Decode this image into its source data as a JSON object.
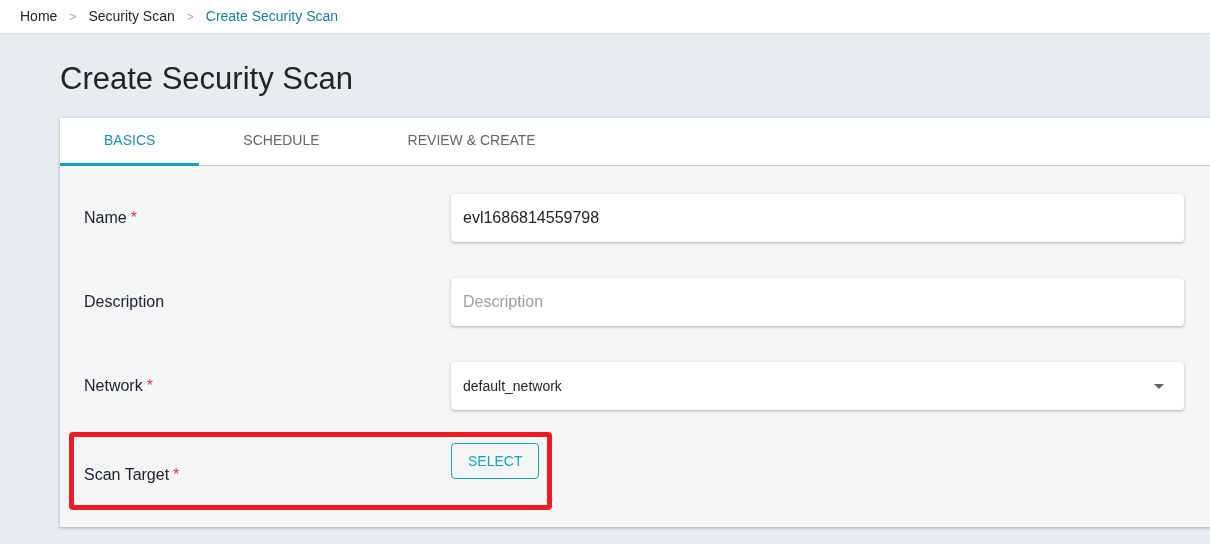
{
  "breadcrumb": [
    {
      "label": "Home",
      "current": false
    },
    {
      "label": "Security Scan",
      "current": false
    },
    {
      "label": "Create Security Scan",
      "current": true
    }
  ],
  "breadcrumb_separator": ">",
  "page_title": "Create Security Scan",
  "tabs": [
    {
      "label": "BASICS",
      "selected": true
    },
    {
      "label": "SCHEDULE",
      "selected": false
    },
    {
      "label": "REVIEW & CREATE",
      "selected": false
    }
  ],
  "fields": [
    {
      "kind": "text",
      "label": "Name",
      "required_mark": "*",
      "value": "evl1686814559798",
      "highlighted": false
    },
    {
      "kind": "text",
      "label": "Description",
      "placeholder": "Description",
      "highlighted": false
    },
    {
      "kind": "select",
      "label": "Network",
      "required_mark": "*",
      "value": "default_network",
      "highlighted": false
    },
    {
      "kind": "button",
      "label": "Scan Target",
      "required_mark": "*",
      "button": "SELECT",
      "highlighted": true
    }
  ]
}
